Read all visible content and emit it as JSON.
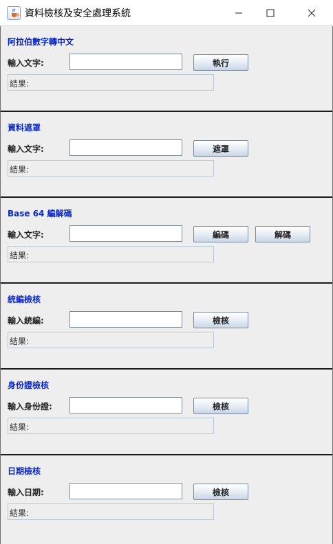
{
  "window": {
    "title": "資料檢核及安全處理系統",
    "icon": "java-cup-icon",
    "controls": [
      "minimize-icon",
      "maximize-icon",
      "close-icon"
    ]
  },
  "colors": {
    "section_title": "#0a28c8",
    "background": "#eeeeee"
  },
  "sections": [
    {
      "title": "阿拉伯數字轉中文",
      "label": "輸入文字:",
      "input_value": "",
      "buttons": [
        "執行"
      ],
      "result": "結果:"
    },
    {
      "title": "資料遮罩",
      "label": "輸入文字:",
      "input_value": "",
      "buttons": [
        "遮罩"
      ],
      "result": "結果:"
    },
    {
      "title": "Base 64 編解碼",
      "label": "輸入文字:",
      "input_value": "",
      "buttons": [
        "編碼",
        "解碼"
      ],
      "result": "結果:"
    },
    {
      "title": "統編檢核",
      "label": "輸入統編:",
      "input_value": "",
      "buttons": [
        "檢核"
      ],
      "result": "結果:"
    },
    {
      "title": "身份證檢核",
      "label": "輸入身份證:",
      "input_value": "",
      "buttons": [
        "檢核"
      ],
      "result": "結果:"
    },
    {
      "title": "日期檢核",
      "label": "輸入日期:",
      "input_value": "",
      "buttons": [
        "檢核"
      ],
      "result": "結果:"
    }
  ]
}
